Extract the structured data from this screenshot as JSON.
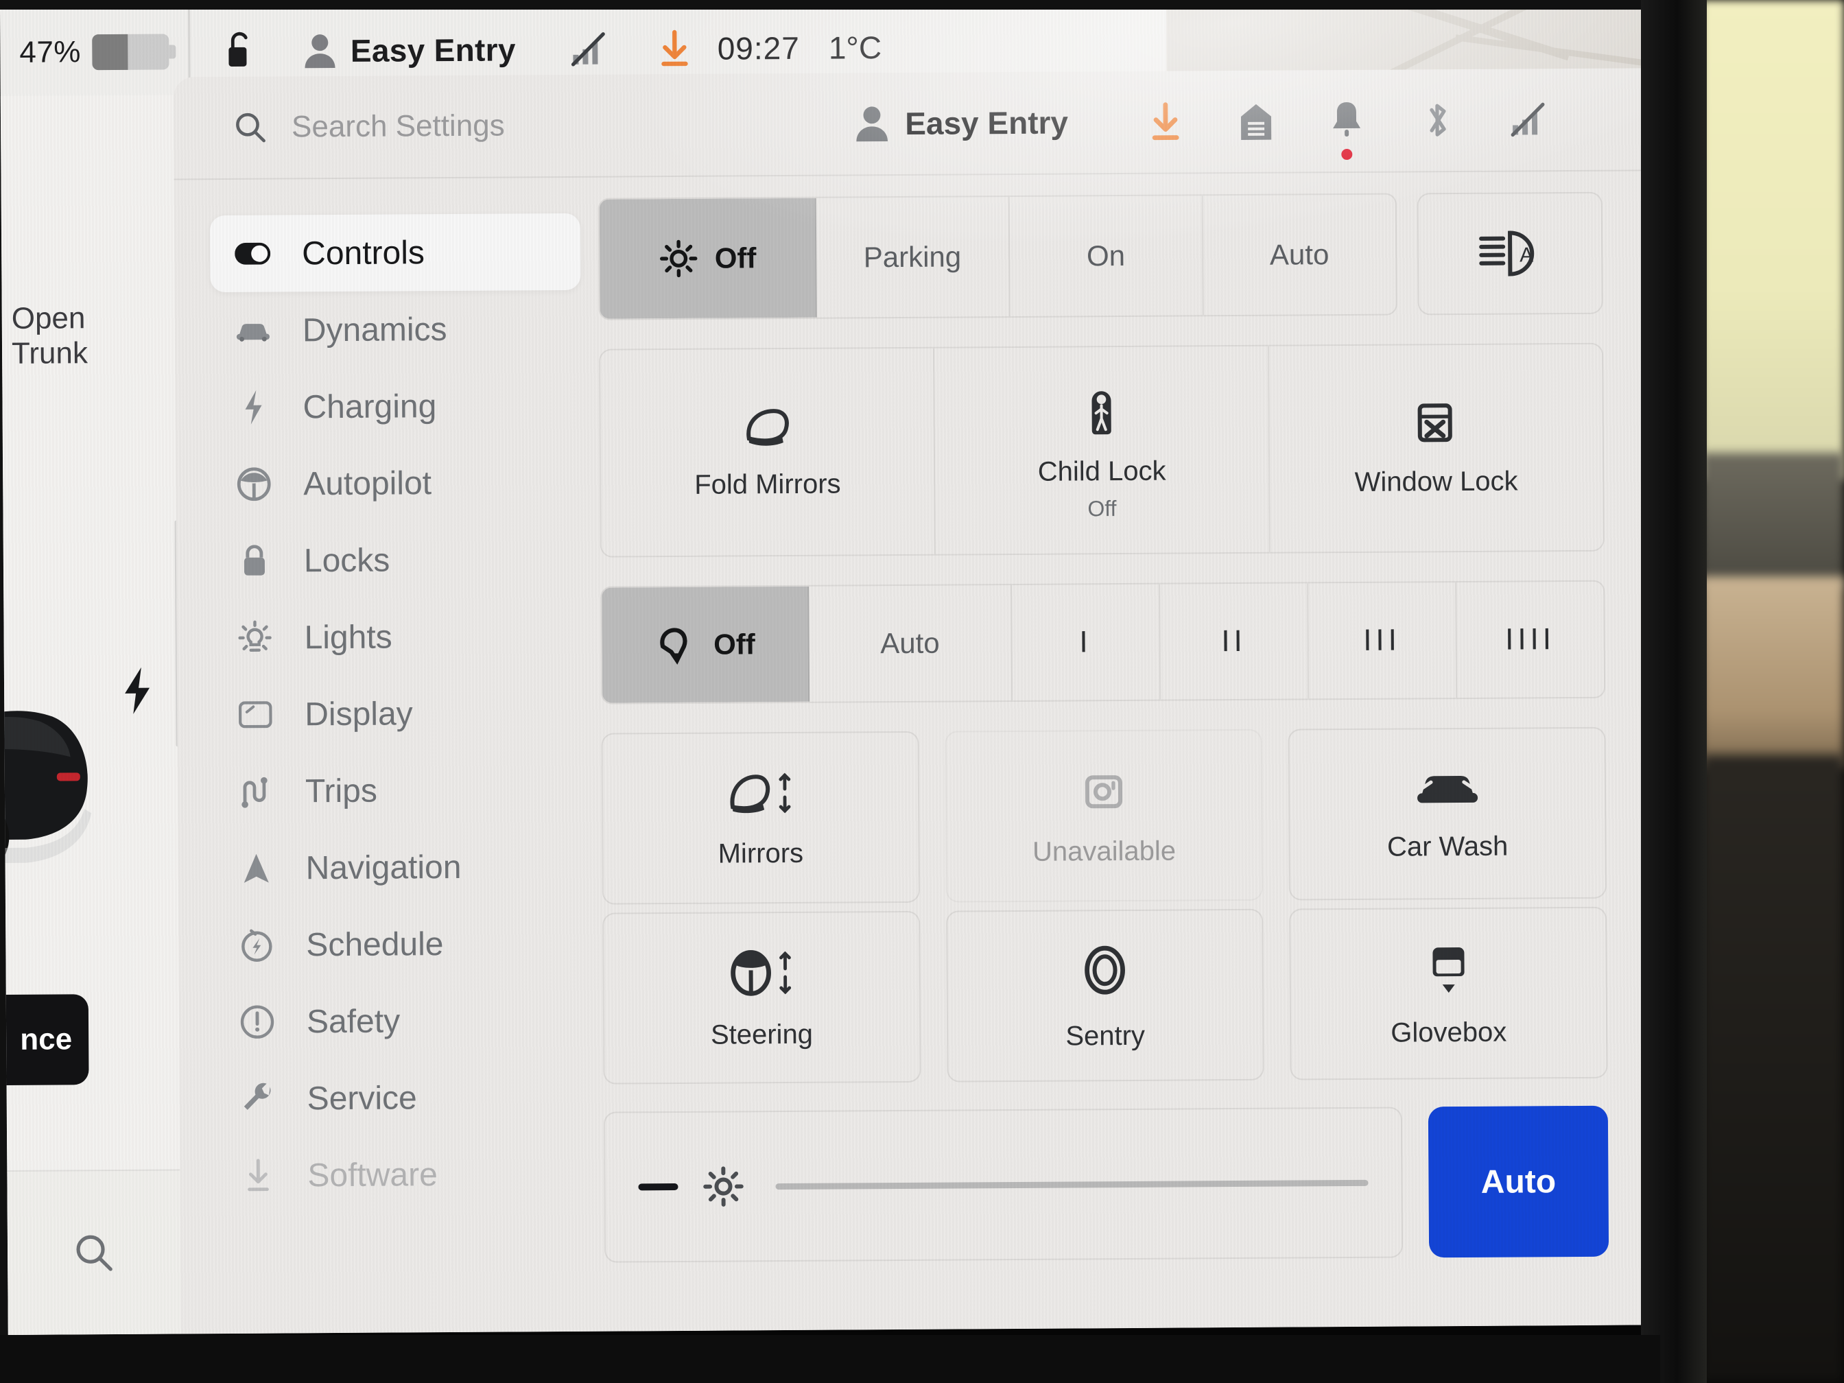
{
  "statusbar": {
    "battery_percent": "47%",
    "battery_level": 47,
    "lock_icon": "unlocked-padlock-icon",
    "profile_icon": "person-icon",
    "profile_name": "Easy Entry",
    "signal_icon": "signal-off-icon",
    "download_icon": "software-download-icon",
    "time": "09:27",
    "temperature": "1°C"
  },
  "car_panel": {
    "open_trunk_label": "Open Trunk",
    "charge_icon": "charge-bolt-icon",
    "range_pill_text": "nce",
    "search_icon": "search-icon",
    "car_image": "tesla-rear-view"
  },
  "settings_header": {
    "search_icon": "search-icon",
    "search_value": "",
    "search_placeholder": "Search Settings",
    "profile_icon": "person-icon",
    "profile_name": "Easy Entry",
    "icons": [
      {
        "name": "software-download-icon",
        "color": "#ef8236"
      },
      {
        "name": "garage-door-icon",
        "color": "#6f7276"
      },
      {
        "name": "bell-icon",
        "color": "#6f7276",
        "badge": true
      },
      {
        "name": "bluetooth-icon",
        "color": "#8b8e92"
      },
      {
        "name": "signal-off-icon",
        "color": "#8b8e92"
      }
    ],
    "badge_color": "#e0162a"
  },
  "sidebar": {
    "items": [
      {
        "label": "Controls",
        "icon": "toggle-switch-icon",
        "active": true
      },
      {
        "label": "Dynamics",
        "icon": "car-front-icon",
        "active": false
      },
      {
        "label": "Charging",
        "icon": "lightning-bolt-icon",
        "active": false
      },
      {
        "label": "Autopilot",
        "icon": "steering-wheel-icon",
        "active": false
      },
      {
        "label": "Locks",
        "icon": "padlock-icon",
        "active": false
      },
      {
        "label": "Lights",
        "icon": "light-bulb-icon",
        "active": false
      },
      {
        "label": "Display",
        "icon": "display-screen-icon",
        "active": false
      },
      {
        "label": "Trips",
        "icon": "winding-road-icon",
        "active": false
      },
      {
        "label": "Navigation",
        "icon": "navigation-arrow-icon",
        "active": false
      },
      {
        "label": "Schedule",
        "icon": "scheduled-charge-icon",
        "active": false
      },
      {
        "label": "Safety",
        "icon": "alert-circle-icon",
        "active": false
      },
      {
        "label": "Service",
        "icon": "wrench-icon",
        "active": false
      },
      {
        "label": "Software",
        "icon": "download-arrow-icon",
        "active": false
      }
    ]
  },
  "controls": {
    "headlights": {
      "icon": "headlight-icon",
      "options": [
        "Off",
        "Parking",
        "On",
        "Auto"
      ],
      "selected": "Off",
      "auto_highbeam_icon": "auto-high-beam-icon"
    },
    "lock_cards": [
      {
        "label": "Fold Mirrors",
        "sub": "",
        "icon": "side-mirror-icon"
      },
      {
        "label": "Child Lock",
        "sub": "Off",
        "icon": "child-lock-icon"
      },
      {
        "label": "Window Lock",
        "sub": "",
        "icon": "window-lock-icon"
      }
    ],
    "wipers": {
      "icon": "wiper-icon",
      "options": [
        "Off",
        "Auto",
        "I",
        "II",
        "III",
        "IIII"
      ],
      "selected": "Off"
    },
    "tiles": [
      {
        "label": "Mirrors",
        "icon": "mirror-adjust-icon",
        "disabled": false
      },
      {
        "label": "Unavailable",
        "icon": "camera-icon",
        "disabled": true
      },
      {
        "label": "Car Wash",
        "icon": "car-wash-icon",
        "disabled": false
      },
      {
        "label": "Steering",
        "icon": "steering-adjust-icon",
        "disabled": false
      },
      {
        "label": "Sentry",
        "icon": "sentry-mode-icon",
        "disabled": false
      },
      {
        "label": "Glovebox",
        "icon": "glovebox-icon",
        "disabled": false
      }
    ],
    "brightness": {
      "minus_icon": "minus-icon",
      "brightness_icon": "brightness-icon",
      "value": 0,
      "auto_label": "Auto",
      "auto_color": "#1344d6"
    }
  }
}
